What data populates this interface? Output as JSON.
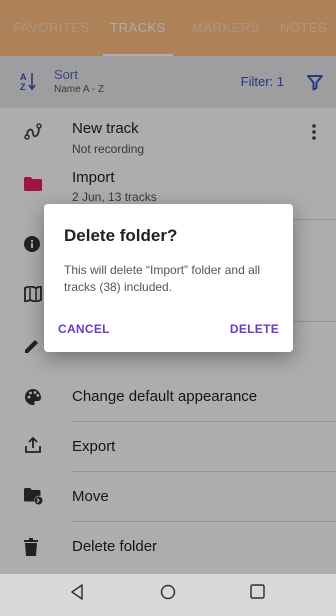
{
  "tabs": [
    {
      "label": "FAVORITES",
      "active": false
    },
    {
      "label": "TRACKS",
      "active": true
    },
    {
      "label": "MARKERS",
      "active": false
    },
    {
      "label": "NOTES",
      "active": false
    }
  ],
  "sort": {
    "title": "Sort",
    "subtitle": "Name A - Z",
    "icon": "sort-az-icon"
  },
  "filter": {
    "label": "Filter: 1",
    "icon": "filter-icon"
  },
  "tracks": {
    "new_track": {
      "title": "New track",
      "subtitle": "Not recording"
    },
    "import_folder": {
      "title": "Import",
      "subtitle": "2 Jun, 13 tracks"
    }
  },
  "menu": [
    {
      "label": "Change default appearance",
      "icon": "palette-icon"
    },
    {
      "label": "Export",
      "icon": "export-icon"
    },
    {
      "label": "Move",
      "icon": "move-folder-icon"
    },
    {
      "label": "Delete folder",
      "icon": "trash-icon"
    }
  ],
  "dialog": {
    "title": "Delete folder?",
    "message": "This will delete “Import” folder and all tracks (38) included.",
    "cancel": "CANCEL",
    "confirm": "DELETE"
  },
  "colors": {
    "tab_bar": "#ffc083",
    "accent": "#6a3cc6",
    "folder": "#e91e63",
    "link_blue": "#3f51b5"
  }
}
